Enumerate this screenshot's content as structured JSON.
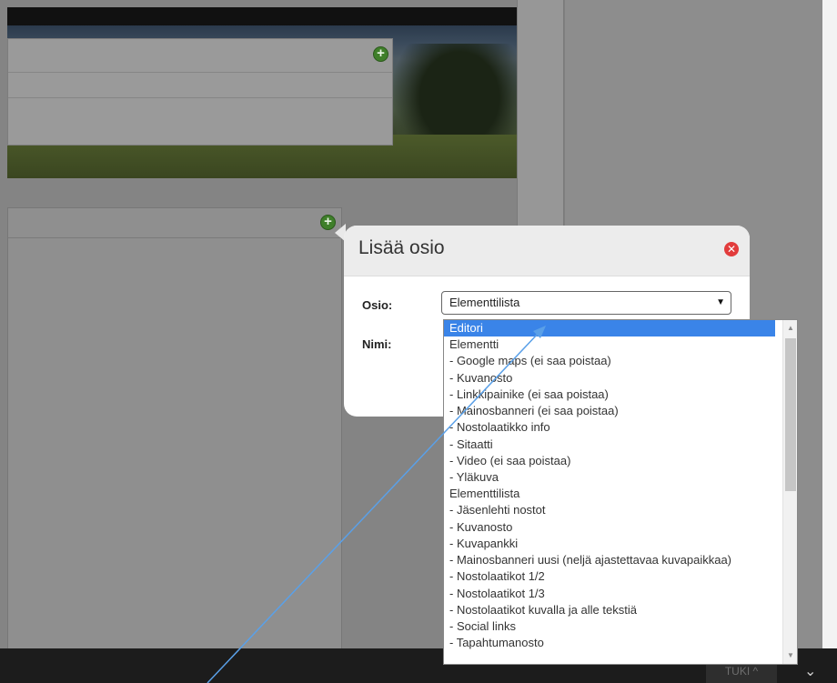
{
  "footer": {
    "tuki_label": "TUKI ^"
  },
  "modal": {
    "title": "Lisää osio",
    "osio_label": "Osio:",
    "nimi_label": "Nimi:",
    "selected_value": "Elementtilista",
    "options": [
      "Editori",
      "Elementti",
      "- Google maps (ei saa poistaa)",
      "- Kuvanosto",
      "- Linkkipainike (ei saa poistaa)",
      "- Mainosbanneri (ei saa poistaa)",
      "- Nostolaatikko info",
      "- Sitaatti",
      "- Video (ei saa poistaa)",
      "- Yläkuva",
      "Elementtilista",
      "- Jäsenlehti nostot",
      "- Kuvanosto",
      "- Kuvapankki",
      "- Mainosbanneri uusi (neljä ajastettavaa kuvapaikkaa)",
      "- Nostolaatikot 1/2",
      "- Nostolaatikot 1/3",
      "- Nostolaatikot kuvalla ja alle tekstiä",
      "- Social links",
      "- Tapahtumanosto"
    ],
    "highlighted_index": 0
  },
  "colors": {
    "accent_selected": "#3a84e8",
    "add_green": "#3f7f2a",
    "close_red": "#e23c3c",
    "annotation_arrow": "#5aa0e8"
  },
  "icons": {
    "add": "plus-circle-icon",
    "close": "close-circle-icon",
    "dropdown": "caret-down-icon",
    "footer_chevron": "chevron-down-icon"
  }
}
